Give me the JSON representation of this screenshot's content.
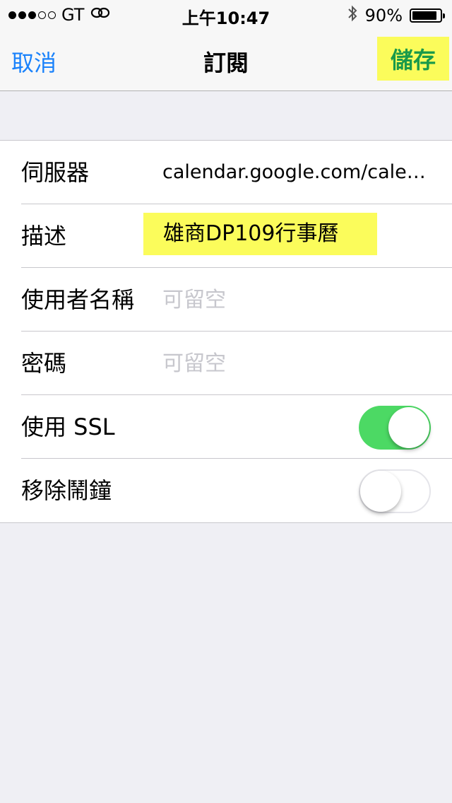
{
  "status_bar": {
    "carrier": "GT",
    "signal_bars_filled": 3,
    "signal_bars_total": 5,
    "time": "上午10:47",
    "battery_percent": "90%",
    "battery_level": 0.9
  },
  "nav": {
    "cancel_label": "取消",
    "title": "訂閱",
    "save_label": "儲存"
  },
  "form": {
    "server": {
      "label": "伺服器",
      "value": "calendar.google.com/calen..."
    },
    "description": {
      "label": "描述",
      "value": "雄商DP109行事曆"
    },
    "username": {
      "label": "使用者名稱",
      "placeholder": "可留空",
      "value": ""
    },
    "password": {
      "label": "密碼",
      "placeholder": "可留空",
      "value": ""
    },
    "ssl": {
      "label": "使用 SSL",
      "on": true
    },
    "remove_alarms": {
      "label": "移除鬧鐘",
      "on": false
    }
  },
  "colors": {
    "accent": "#1a82fb",
    "highlight": "#fbfc5b",
    "save_text": "#1a9a4a",
    "toggle_on": "#4cd964",
    "background": "#efeff4"
  }
}
